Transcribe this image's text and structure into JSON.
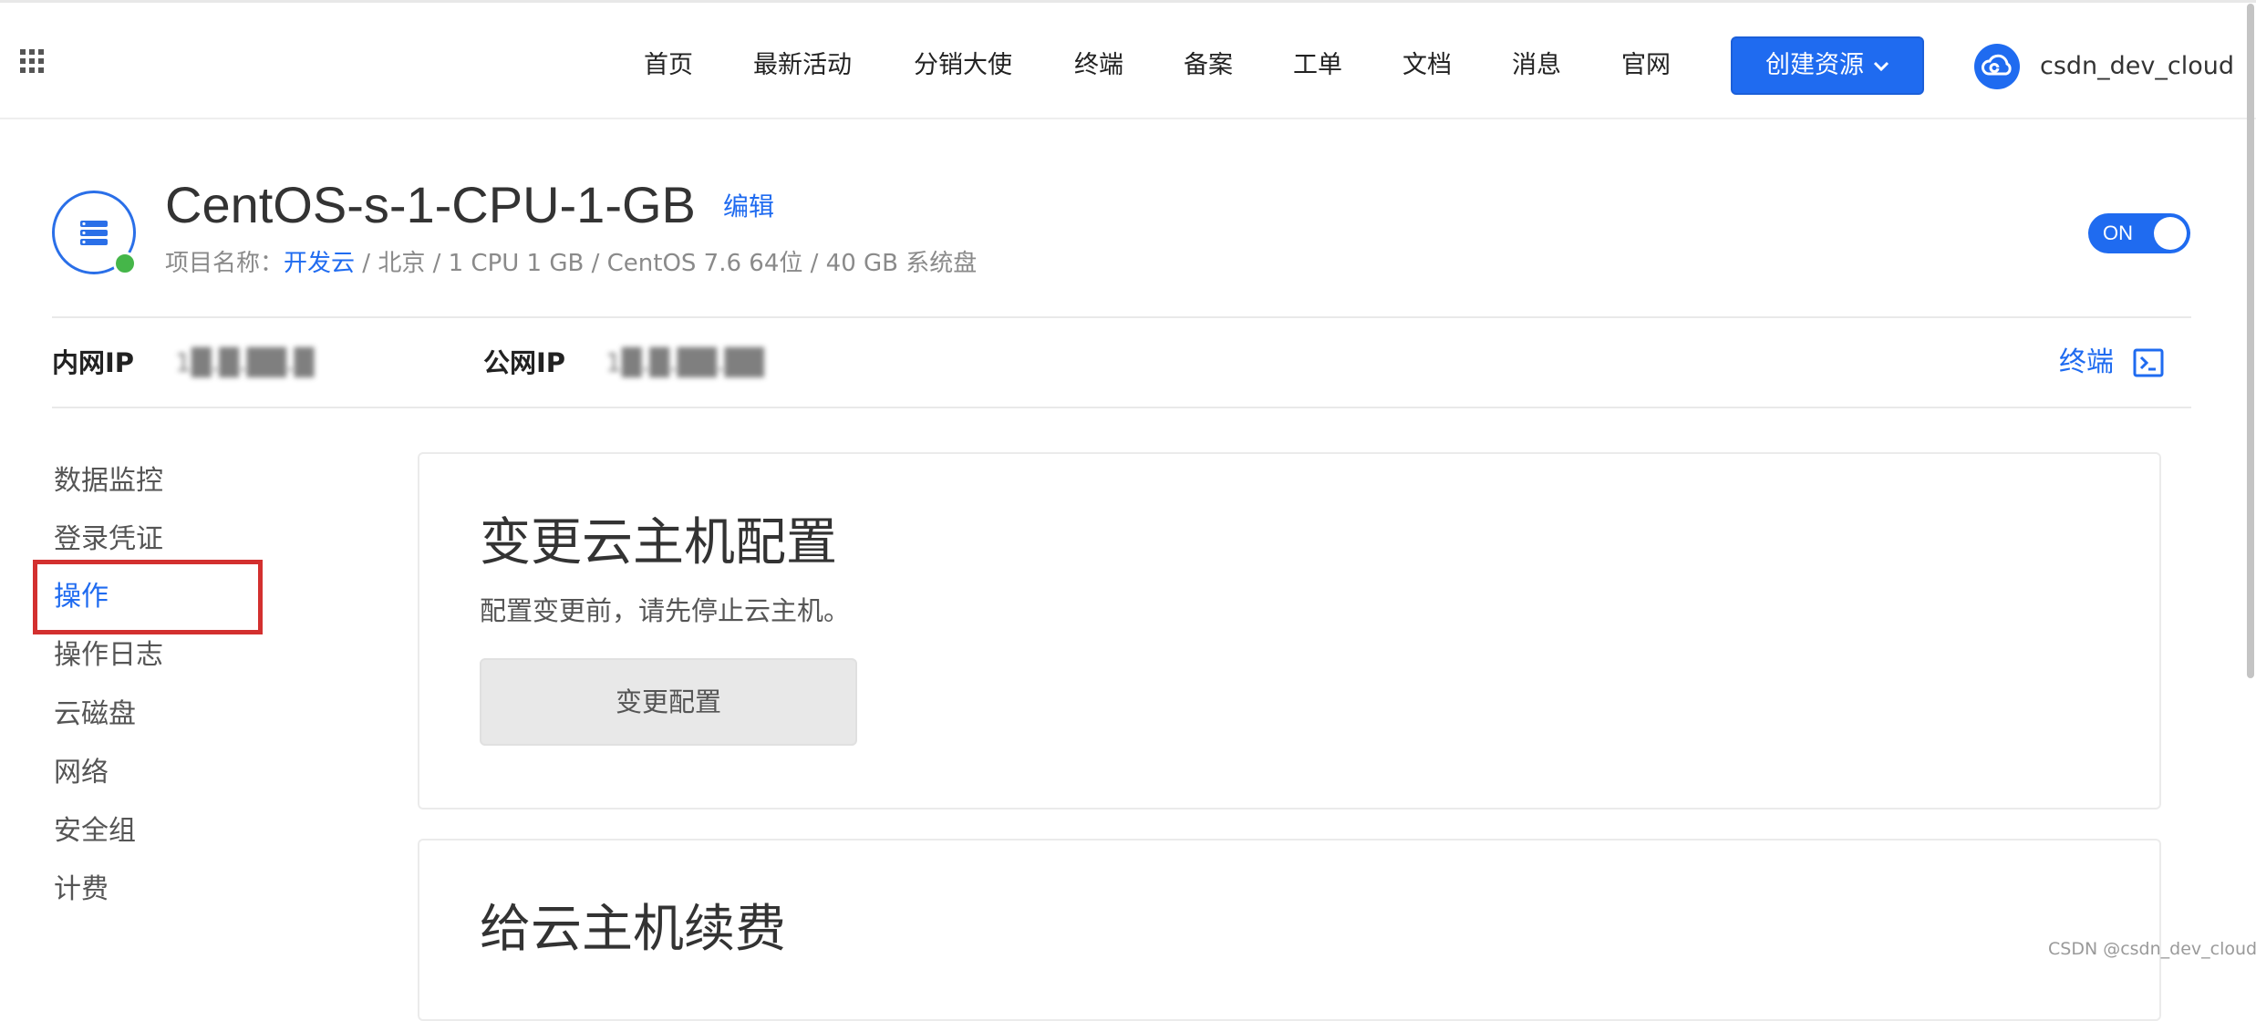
{
  "topbar": {
    "nav": [
      {
        "label": "首页",
        "name": "nav-home"
      },
      {
        "label": "最新活动",
        "name": "nav-latest-activities"
      },
      {
        "label": "分销大使",
        "name": "nav-distribution-ambassador"
      },
      {
        "label": "终端",
        "name": "nav-terminal"
      },
      {
        "label": "备案",
        "name": "nav-filing"
      },
      {
        "label": "工单",
        "name": "nav-ticket"
      },
      {
        "label": "文档",
        "name": "nav-docs"
      },
      {
        "label": "消息",
        "name": "nav-messages"
      },
      {
        "label": "官网",
        "name": "nav-official-site"
      }
    ],
    "create_button": "创建资源",
    "username": "csdn_dev_cloud"
  },
  "instance": {
    "title": "CentOS-s-1-CPU-1-GB",
    "edit_label": "编辑",
    "project_prefix": "项目名称：",
    "project_name": "开发云",
    "spec": " / 北京 /  1 CPU 1 GB / CentOS 7.6 64位 / 40 GB 系统盘",
    "power_toggle": "ON",
    "status_color": "#45b649"
  },
  "ips": {
    "private_label": "内网IP",
    "private_value": "1█.█.██.█",
    "public_label": "公网IP",
    "public_value": "1█.█.██.██",
    "terminal_label": "终端"
  },
  "sidebar": {
    "items": [
      {
        "label": "数据监控",
        "active": false
      },
      {
        "label": "登录凭证",
        "active": false
      },
      {
        "label": "操作",
        "active": true
      },
      {
        "label": "操作日志",
        "active": false
      },
      {
        "label": "云磁盘",
        "active": false
      },
      {
        "label": "网络",
        "active": false
      },
      {
        "label": "安全组",
        "active": false
      },
      {
        "label": "计费",
        "active": false
      }
    ]
  },
  "cards": {
    "change_config": {
      "title": "变更云主机配置",
      "description": "配置变更前，请先停止云主机。",
      "button": "变更配置"
    },
    "renew": {
      "title": "给云主机续费"
    }
  },
  "colors": {
    "accent": "#1f6bf0",
    "highlight": "#d3302f"
  },
  "watermark": "CSDN @csdn_dev_cloud"
}
